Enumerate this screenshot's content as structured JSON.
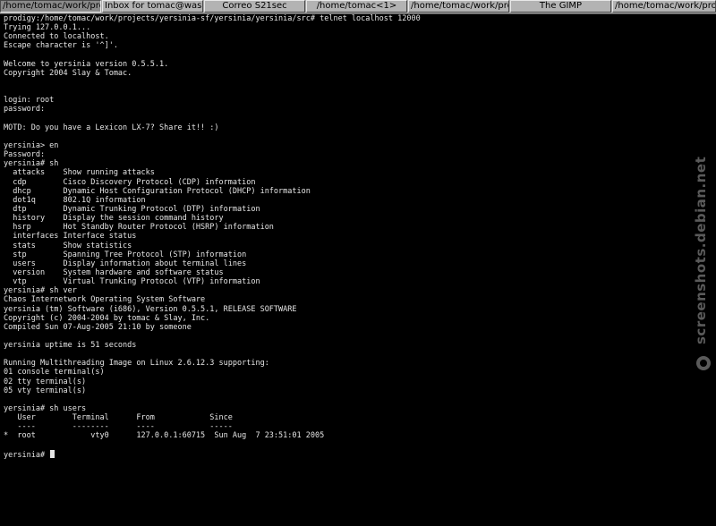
{
  "taskbar": {
    "tasks": [
      {
        "label": "/home/tomac/work/proj...",
        "active": true
      },
      {
        "label": "Inbox for tomac@wasa...",
        "active": false
      },
      {
        "label": "Correo S21sec",
        "active": false
      },
      {
        "label": "/home/tomac<1>",
        "active": false
      },
      {
        "label": "/home/tomac/work/proj...",
        "active": false
      },
      {
        "label": "The GIMP",
        "active": false
      },
      {
        "label": "/home/tomac/work/proje...",
        "active": false
      }
    ]
  },
  "terminal": {
    "lines": [
      "prodigy:/home/tomac/work/projects/yersinia-sf/yersinia/yersinia/src# telnet localhost 12000",
      "Trying 127.0.0.1...",
      "Connected to localhost.",
      "Escape character is '^]'.",
      "",
      "Welcome to yersinia version 0.5.5.1.",
      "Copyright 2004 Slay & Tomac.",
      "",
      "",
      "login: root",
      "password:",
      "",
      "MOTD: Do you have a Lexicon LX-7? Share it!! :)",
      "",
      "yersinia> en",
      "Password:",
      "yersinia# sh",
      "  attacks    Show running attacks",
      "  cdp        Cisco Discovery Protocol (CDP) information",
      "  dhcp       Dynamic Host Configuration Protocol (DHCP) information",
      "  dot1q      802.1Q information",
      "  dtp        Dynamic Trunking Protocol (DTP) information",
      "  history    Display the session command history",
      "  hsrp       Hot Standby Router Protocol (HSRP) information",
      "  interfaces Interface status",
      "  stats      Show statistics",
      "  stp        Spanning Tree Protocol (STP) information",
      "  users      Display information about terminal lines",
      "  version    System hardware and software status",
      "  vtp        Virtual Trunking Protocol (VTP) information",
      "yersinia# sh ver",
      "Chaos Internetwork Operating System Software",
      "yersinia (tm) Software (i686), Version 0.5.5.1, RELEASE SOFTWARE",
      "Copyright (c) 2004-2004 by tomac & Slay, Inc.",
      "Compiled Sun 07-Aug-2005 21:10 by someone",
      "",
      "yersinia uptime is 51 seconds",
      "",
      "Running Multithreading Image on Linux 2.6.12.3 supporting:",
      "01 console terminal(s)",
      "02 tty terminal(s)",
      "05 vty terminal(s)",
      "",
      "yersinia# sh users",
      "   User        Terminal      From            Since",
      "   ----        --------      ----            -----",
      "*  root            vty0      127.0.0.1:60715  Sun Aug  7 23:51:01 2005",
      "",
      "yersinia# "
    ]
  },
  "watermark": {
    "text": "screenshots.debian.net",
    "icon": "debian-swirl-icon"
  }
}
